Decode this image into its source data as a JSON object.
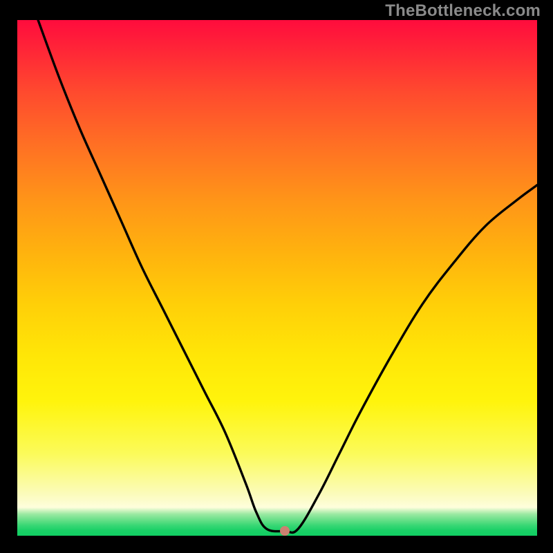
{
  "watermark": "TheBottleneck.com",
  "marker": {
    "x_pct": 51.5,
    "y_pct": 99.1
  },
  "chart_data": {
    "type": "line",
    "title": "",
    "xlabel": "",
    "ylabel": "",
    "xlim": [
      0,
      100
    ],
    "ylim": [
      0,
      100
    ],
    "grid": false,
    "legend": false,
    "annotations": [
      {
        "text": "TheBottleneck.com",
        "position": "top-right"
      }
    ],
    "marker_point": {
      "x": 51.5,
      "y": 0.9,
      "color": "#cc8071"
    },
    "series": [
      {
        "name": "bottleneck-curve",
        "x": [
          4,
          8,
          12,
          16,
          20,
          24,
          28,
          32,
          36,
          40,
          44,
          46,
          48,
          51.5,
          54,
          58,
          62,
          66,
          72,
          78,
          84,
          90,
          96,
          100
        ],
        "y": [
          100,
          89,
          79,
          70,
          61,
          52,
          44,
          36,
          28,
          20,
          10,
          4.5,
          1.3,
          0.9,
          1.3,
          8,
          16,
          24,
          35,
          45,
          53,
          60,
          65,
          68
        ],
        "notes": "y is bottleneck percentage (higher = worse / red zone); the curve dips to ~0 at x≈51.5 then rises again."
      }
    ],
    "background_gradient_description": "Vertical gradient of plot area encodes y value: top (y≈100) is red → orange → yellow towards middle → pale yellow/cream near y≈5 → green at y≈0 (bottom)."
  }
}
